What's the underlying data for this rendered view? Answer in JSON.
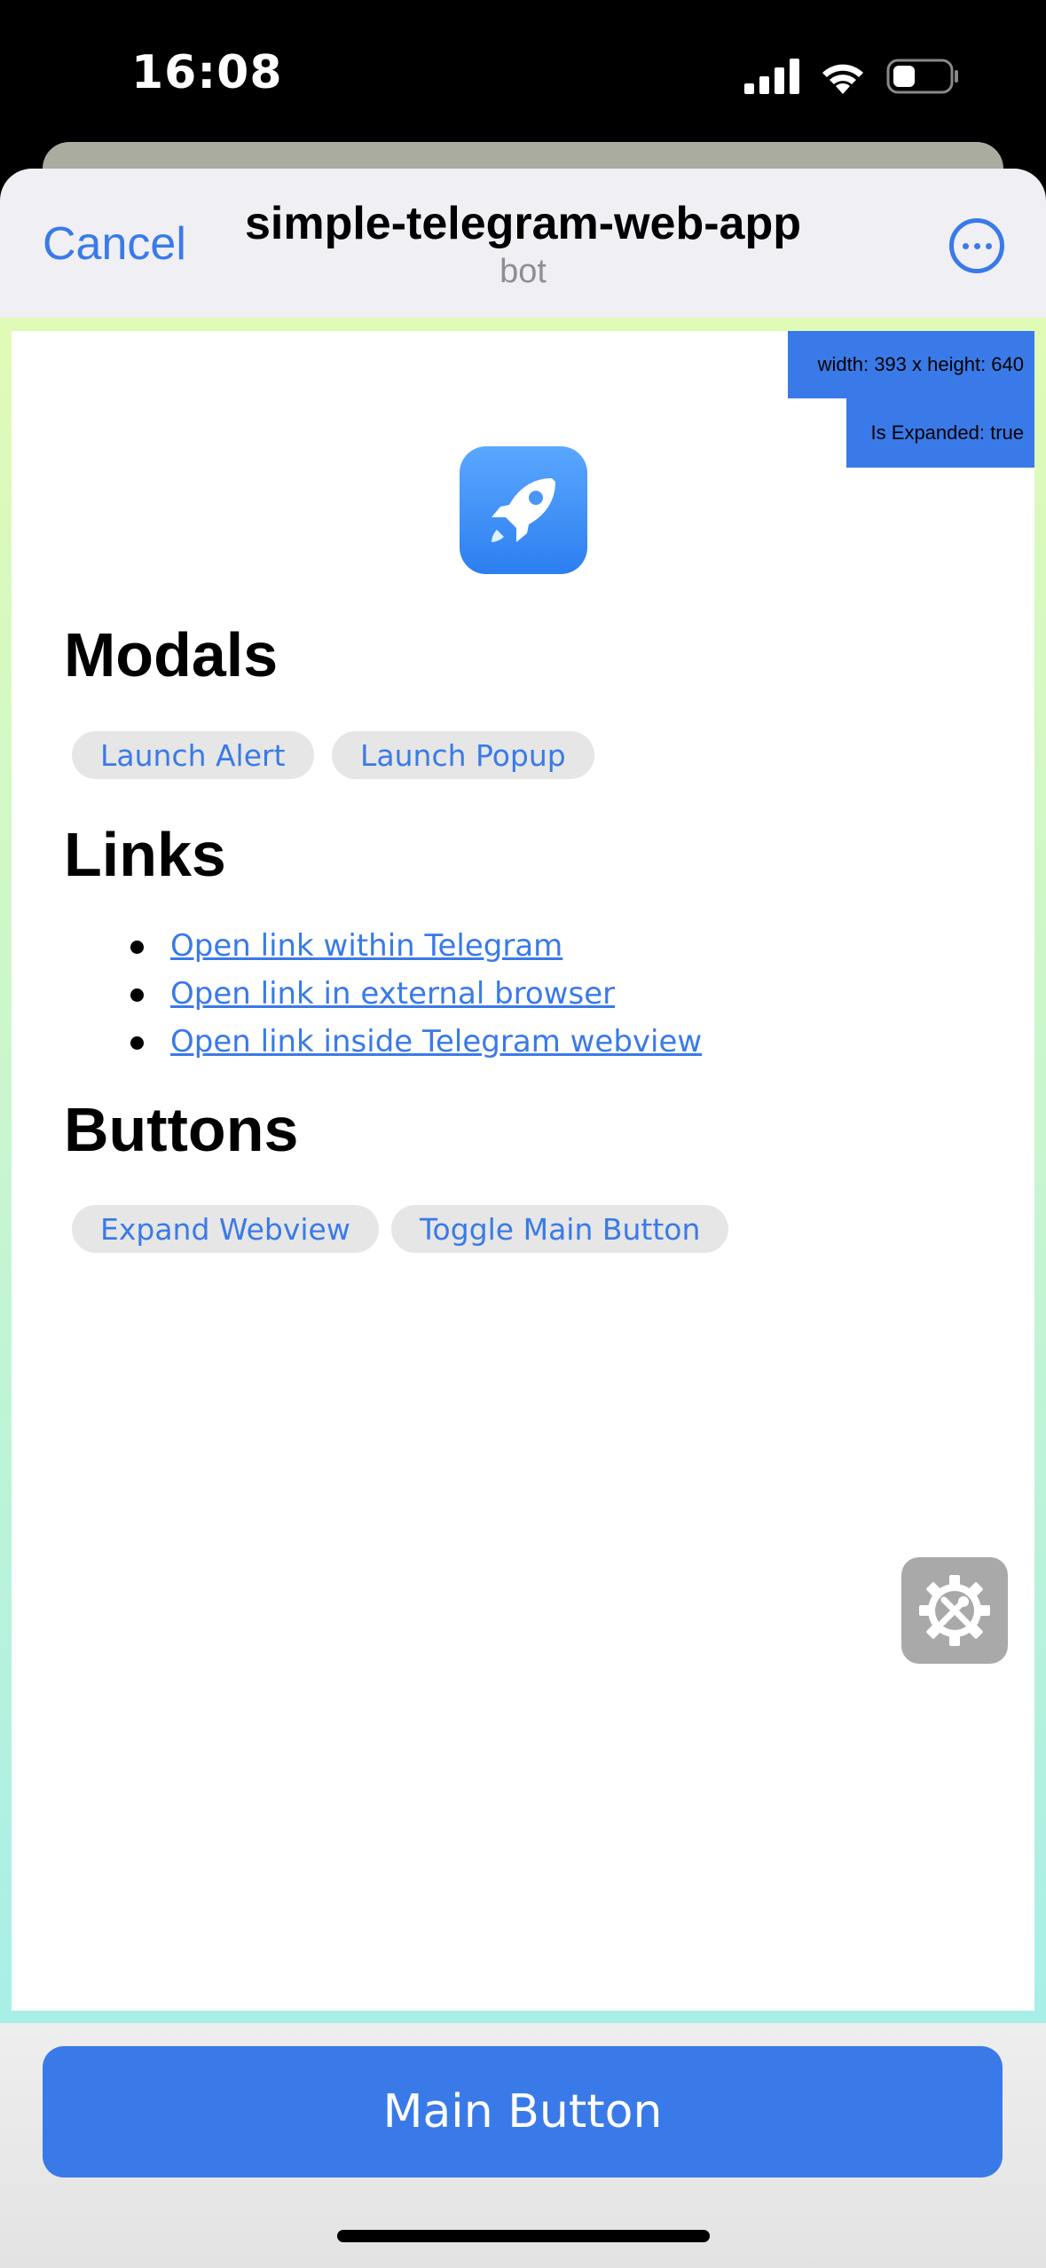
{
  "status_bar": {
    "time": "16:08",
    "icons": [
      "signal-icon",
      "wifi-icon",
      "battery-icon"
    ]
  },
  "header": {
    "cancel_label": "Cancel",
    "title": "simple-telegram-web-app",
    "subtitle": "bot",
    "more_icon": "more-icon"
  },
  "info": {
    "size": "width: 393 x height: 640",
    "expanded": "Is Expanded: true"
  },
  "app_icon": "rocket-icon",
  "modals": {
    "heading": "Modals",
    "buttons": [
      "Launch Alert",
      "Launch Popup"
    ]
  },
  "links": {
    "heading": "Links",
    "items": [
      "Open link within Telegram",
      "Open link in external browser",
      "Open link inside Telegram webview"
    ]
  },
  "buttons_section": {
    "heading": "Buttons",
    "buttons": [
      "Expand Webview",
      "Toggle Main Button"
    ]
  },
  "settings_icon": "settings-tools-icon",
  "main_button": {
    "label": "Main Button"
  },
  "colors": {
    "accent": "#3a7ae8",
    "pill_bg": "#e6e6e6",
    "header_bg": "#efeff4"
  }
}
